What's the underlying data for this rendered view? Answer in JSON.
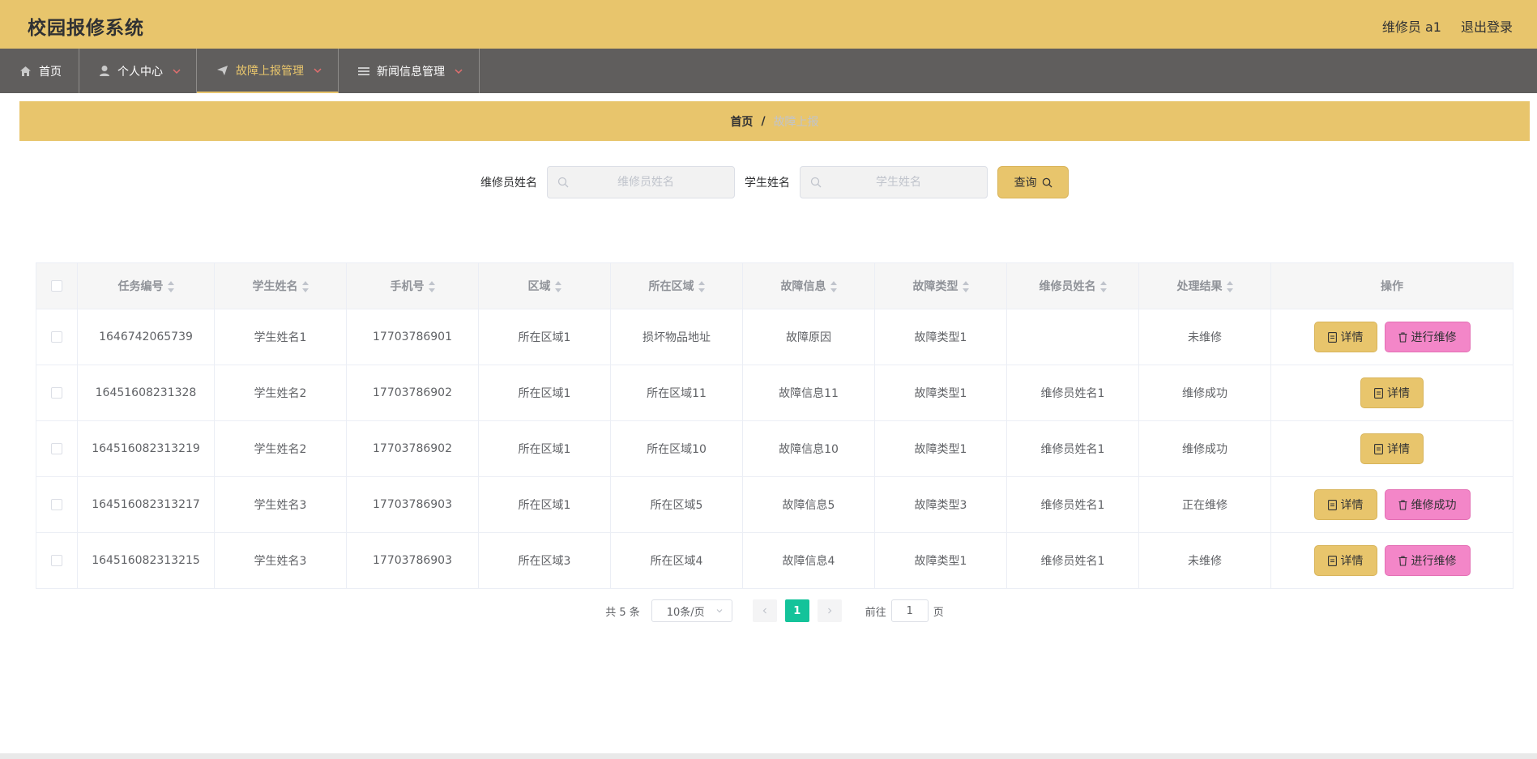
{
  "header": {
    "title": "校园报修系统",
    "user_label": "维修员 a1",
    "logout_label": "退出登录"
  },
  "nav": {
    "items": [
      {
        "label": "首页",
        "icon": "home-icon"
      },
      {
        "label": "个人中心",
        "icon": "user-icon"
      },
      {
        "label": "故障上报管理",
        "icon": "paper-plane-icon",
        "active": true
      },
      {
        "label": "新闻信息管理",
        "icon": "list-icon"
      }
    ]
  },
  "breadcrumb": {
    "home": "首页",
    "separator": "/",
    "current": "故障上报"
  },
  "search": {
    "repairer_label": "维修员姓名",
    "repairer_placeholder": "维修员姓名",
    "student_label": "学生姓名",
    "student_placeholder": "学生姓名",
    "query_label": "查询"
  },
  "table": {
    "columns": [
      "任务编号",
      "学生姓名",
      "手机号",
      "区域",
      "所在区域",
      "故障信息",
      "故障类型",
      "维修员姓名",
      "处理结果",
      "操作"
    ],
    "rows": [
      {
        "id": "1646742065739",
        "student": "学生姓名1",
        "phone": "17703786901",
        "area": "所在区域1",
        "location": "损坏物品地址",
        "fault": "故障原因",
        "type": "故障类型1",
        "repairer": "",
        "result": "未维修",
        "action": "进行维修"
      },
      {
        "id": "16451608231328",
        "student": "学生姓名2",
        "phone": "17703786902",
        "area": "所在区域1",
        "location": "所在区域11",
        "fault": "故障信息11",
        "type": "故障类型1",
        "repairer": "维修员姓名1",
        "result": "维修成功",
        "action": ""
      },
      {
        "id": "164516082313219",
        "student": "学生姓名2",
        "phone": "17703786902",
        "area": "所在区域1",
        "location": "所在区域10",
        "fault": "故障信息10",
        "type": "故障类型1",
        "repairer": "维修员姓名1",
        "result": "维修成功",
        "action": ""
      },
      {
        "id": "164516082313217",
        "student": "学生姓名3",
        "phone": "17703786903",
        "area": "所在区域1",
        "location": "所在区域5",
        "fault": "故障信息5",
        "type": "故障类型3",
        "repairer": "维修员姓名1",
        "result": "正在维修",
        "action": "维修成功"
      },
      {
        "id": "164516082313215",
        "student": "学生姓名3",
        "phone": "17703786903",
        "area": "所在区域3",
        "location": "所在区域4",
        "fault": "故障信息4",
        "type": "故障类型1",
        "repairer": "维修员姓名1",
        "result": "未维修",
        "action": "进行维修"
      }
    ],
    "detail_label": "详情"
  },
  "pagination": {
    "total": "共 5 条",
    "page_size": "10条/页",
    "current_page": "1",
    "goto_label": "前往",
    "goto_value": "1",
    "page_suffix": "页"
  },
  "colors": {
    "accent": "#e8c56c",
    "nav_bg": "#605e5d",
    "action_pink": "#f386c8",
    "page_active": "#14c39a"
  }
}
